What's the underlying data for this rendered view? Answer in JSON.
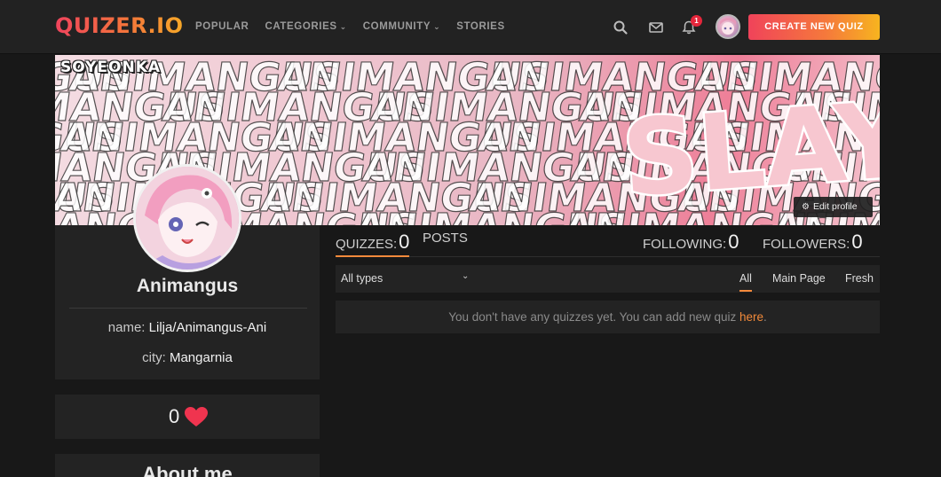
{
  "nav": {
    "logo": "QUIZER.IO",
    "links": [
      {
        "label": "POPULAR",
        "dropdown": false
      },
      {
        "label": "CATEGORIES",
        "dropdown": true
      },
      {
        "label": "COMMUNITY",
        "dropdown": true
      },
      {
        "label": "STORIES",
        "dropdown": false
      }
    ],
    "notification_count": "1",
    "create_button": "CREATE NEW QUIZ"
  },
  "banner": {
    "tag": "SOYEONKA",
    "repeat_word": "ANIMANGUS",
    "slogan": "SLAY!",
    "edit_profile": "Edit profile"
  },
  "profile": {
    "name": "Animangus",
    "name_label": "name:",
    "name_value": "Lilja/Animangus-Ani",
    "city_label": "city:",
    "city_value": "Mangarnia",
    "likes": "0",
    "about_title": "About me"
  },
  "tabs": {
    "quizzes_label": "QUIZZES:",
    "quizzes_count": "0",
    "posts_label": "POSTS",
    "following_label": "FOLLOWING:",
    "following_count": "0",
    "followers_label": "FOLLOWERS:",
    "followers_count": "0"
  },
  "filters": {
    "type_select": "All types",
    "tabs": [
      "All",
      "Main Page",
      "Fresh"
    ],
    "active_tab": "All"
  },
  "empty": {
    "message": "You don't have any quizzes yet. You can add new quiz ",
    "link": "here",
    "end": "."
  },
  "colors": {
    "accent": "#f58a3c",
    "badge": "#e5263b",
    "heart": "#f0344f",
    "background": "#181818",
    "card": "#232323"
  },
  "icons": [
    "search-icon",
    "mail-icon",
    "bell-icon",
    "gear-icon",
    "heart-icon",
    "chevron-down-icon"
  ]
}
